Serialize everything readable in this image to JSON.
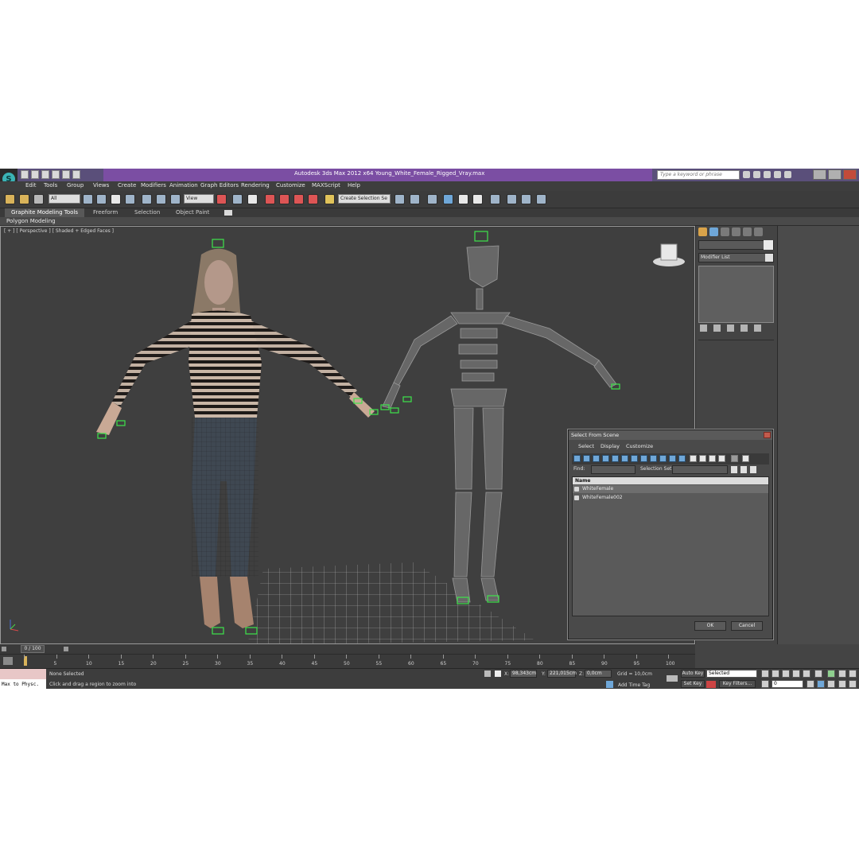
{
  "window": {
    "title": "Autodesk 3ds Max  2012 x64     Young_White_Female_Rigged_Vray.max",
    "search_placeholder": "Type a keyword or phrase"
  },
  "menu": [
    "Edit",
    "Tools",
    "Group",
    "Views",
    "Create",
    "Modifiers",
    "Animation",
    "Graph Editors",
    "Rendering",
    "Customize",
    "MAXScript",
    "Help"
  ],
  "toolbar": {
    "selection_filter": "All",
    "reference_coord": "View",
    "named_selection_placeholder": "Create Selection Se"
  },
  "ribbon": {
    "tabs": [
      "Graphite Modeling Tools",
      "Freeform",
      "Selection",
      "Object Paint"
    ],
    "panel_label": "Polygon Modeling"
  },
  "viewport": {
    "label": "[ + ] [ Perspective ] [ Shaded + Edged Faces ]"
  },
  "command_panel": {
    "modifier_list": "Modifier List"
  },
  "select_dialog": {
    "title": "Select From Scene",
    "menus": [
      "Select",
      "Display",
      "Customize"
    ],
    "find_label": "Find:",
    "selection_set_label": "Selection Set:",
    "column_header": "Name",
    "rows": [
      "WhiteFemale",
      "WhiteFemale002"
    ],
    "ok_label": "OK",
    "cancel_label": "Cancel"
  },
  "timeline": {
    "frame_indicator": "0 / 100",
    "ticks": [
      "0",
      "5",
      "10",
      "15",
      "20",
      "25",
      "30",
      "35",
      "40",
      "45",
      "50",
      "55",
      "60",
      "65",
      "70",
      "75",
      "80",
      "85",
      "90",
      "95",
      "100"
    ]
  },
  "status": {
    "maxscript_text": "Max to Physc.",
    "selection_status": "None Selected",
    "prompt": "Click and drag a region to zoom into",
    "x_label": "X:",
    "x_value": "98,343cm",
    "y_label": "Y:",
    "y_value": "221,015cm",
    "z_label": "Z:",
    "z_value": "0,0cm",
    "grid": "Grid = 10,0cm",
    "add_time_tag": "Add Time Tag",
    "auto_key": "Auto Key",
    "set_key": "Set Key",
    "key_mode": "Selected",
    "key_filters": "Key Filters...",
    "current_frame": "0"
  }
}
